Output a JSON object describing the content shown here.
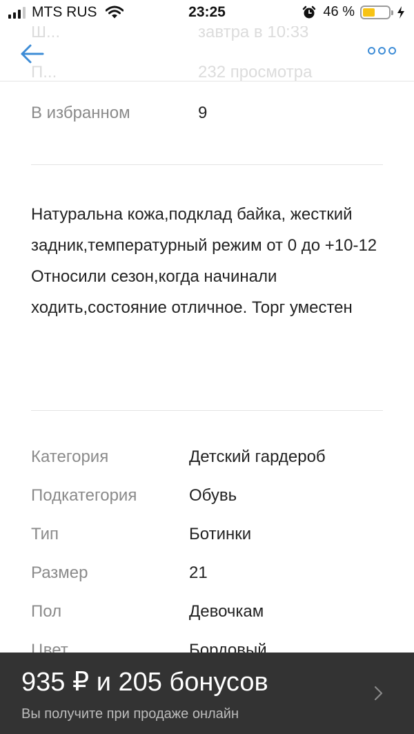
{
  "status_bar": {
    "carrier": "MTS RUS",
    "time": "23:25",
    "battery_percent": "46 %",
    "battery_level": 0.46,
    "signal_bars": 4,
    "signal_bars_active": 3,
    "icons": [
      "signal-icon",
      "wifi-icon",
      "alarm-icon",
      "battery-icon",
      "charging-icon"
    ]
  },
  "nav": {
    "back_icon": "arrow-left-icon",
    "more_icon": "more-dots-icon",
    "accent_color": "#3d8cd6"
  },
  "partially_hidden": {
    "row1_label": "Ш...",
    "row1_value": "завтра в 10:33",
    "row2_label": "П...",
    "row2_value": "232 просмотра"
  },
  "stats": {
    "favorites_label": "В избранном",
    "favorites_value": "9"
  },
  "description": [
    "Натуральна кожа,подклад байка, жесткий задник,температурный режим от 0 до +10-12",
    "Относили сезон,когда начинали ходить,состояние отличное. Торг уместен"
  ],
  "attributes": [
    {
      "label": "Категория",
      "value": "Детский гардероб"
    },
    {
      "label": "Подкатегория",
      "value": "Обувь"
    },
    {
      "label": "Тип",
      "value": "Ботинки"
    },
    {
      "label": "Размер",
      "value": "21"
    },
    {
      "label": "Пол",
      "value": "Девочкам"
    },
    {
      "label": "Цвет",
      "value": "Бордовый"
    }
  ],
  "bottom_panel": {
    "price": "935 ₽ и 205 бонусов",
    "subtitle": "Вы получите при продаже онлайн",
    "background": "#333333"
  }
}
